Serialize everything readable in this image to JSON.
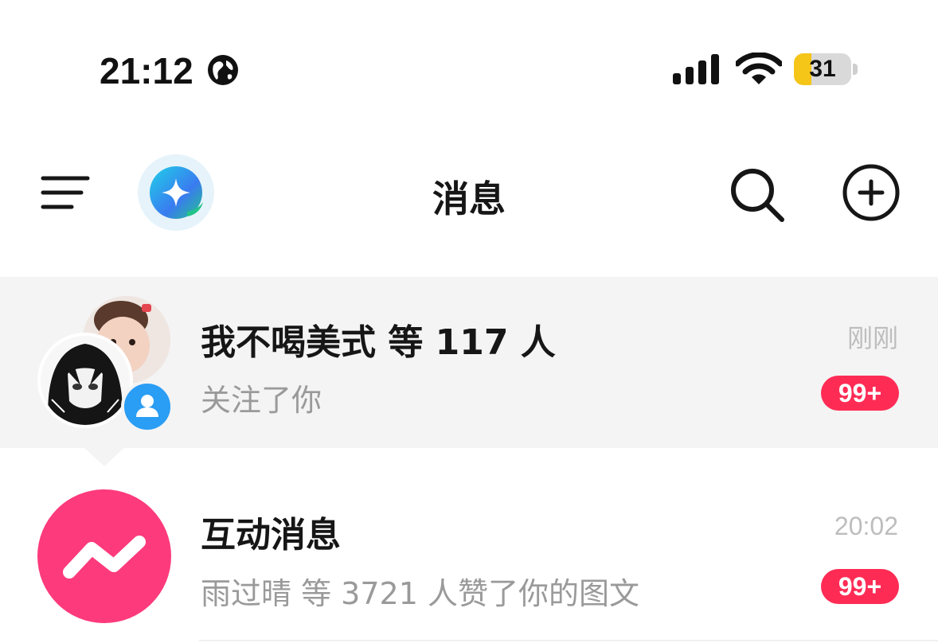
{
  "status_bar": {
    "time": "21:12",
    "battery": "31",
    "battery_fraction": 0.31,
    "icons": [
      "globe-icon",
      "signal-icon",
      "wifi-icon",
      "battery-icon"
    ]
  },
  "header": {
    "title": "消息",
    "icons": [
      "menu-icon",
      "ai-assistant-icon",
      "search-icon",
      "add-icon"
    ]
  },
  "conversations": [
    {
      "title": "我不喝美式 等 117 人",
      "subtitle": "关注了你",
      "time": "刚刚",
      "badge": "99+",
      "icons": [
        "avatar-photo",
        "avatar-anime",
        "follow-user-icon"
      ]
    },
    {
      "title": "互动消息",
      "subtitle": "雨过晴 等 3721 人赞了你的图文",
      "time": "20:02",
      "badge": "99+",
      "icons": [
        "interaction-icon"
      ]
    }
  ],
  "colors": {
    "badge": "#fe2c55",
    "interaction_icon": "#fd3a7c",
    "follow_icon": "#2a9df4",
    "battery_fill": "#f5c518",
    "highlight_row": "#f4f4f4"
  }
}
